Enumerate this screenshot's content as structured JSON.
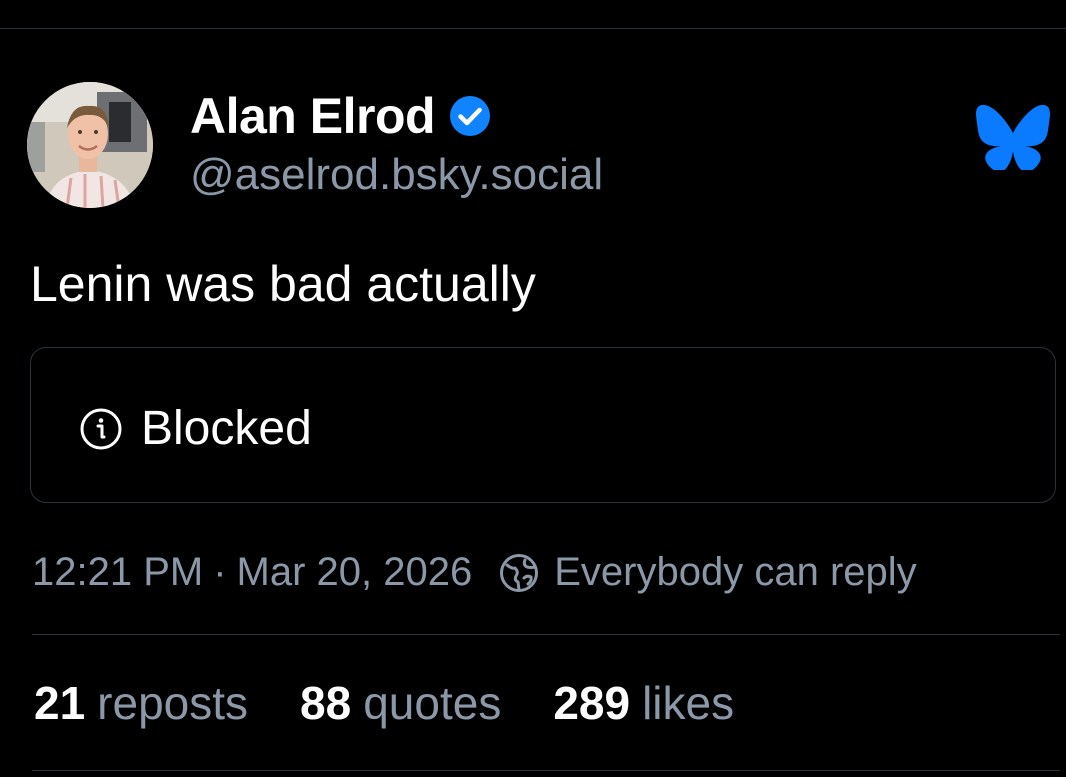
{
  "post": {
    "author": {
      "display_name": "Alan Elrod",
      "handle": "@aselrod.bsky.social",
      "verified": true,
      "avatar_icon": "profile-photo"
    },
    "text": "Lenin was bad actually",
    "embed": {
      "icon": "info-icon",
      "label": "Blocked"
    },
    "timestamp": "12:21 PM",
    "separator": "·",
    "date": "Mar 20, 2026",
    "reply_setting": {
      "icon": "globe-icon",
      "label": "Everybody can reply"
    },
    "stats": {
      "reposts": {
        "count": "21",
        "label": "reposts"
      },
      "quotes": {
        "count": "88",
        "label": "quotes"
      },
      "likes": {
        "count": "289",
        "label": "likes"
      }
    }
  },
  "brand": {
    "icon": "bluesky-butterfly-icon",
    "color": "#0a7aff"
  },
  "colors": {
    "background": "#000000",
    "text_primary": "#ffffff",
    "text_secondary": "#8b98a8",
    "border": "#2b333d",
    "verified": "#1083fe"
  }
}
